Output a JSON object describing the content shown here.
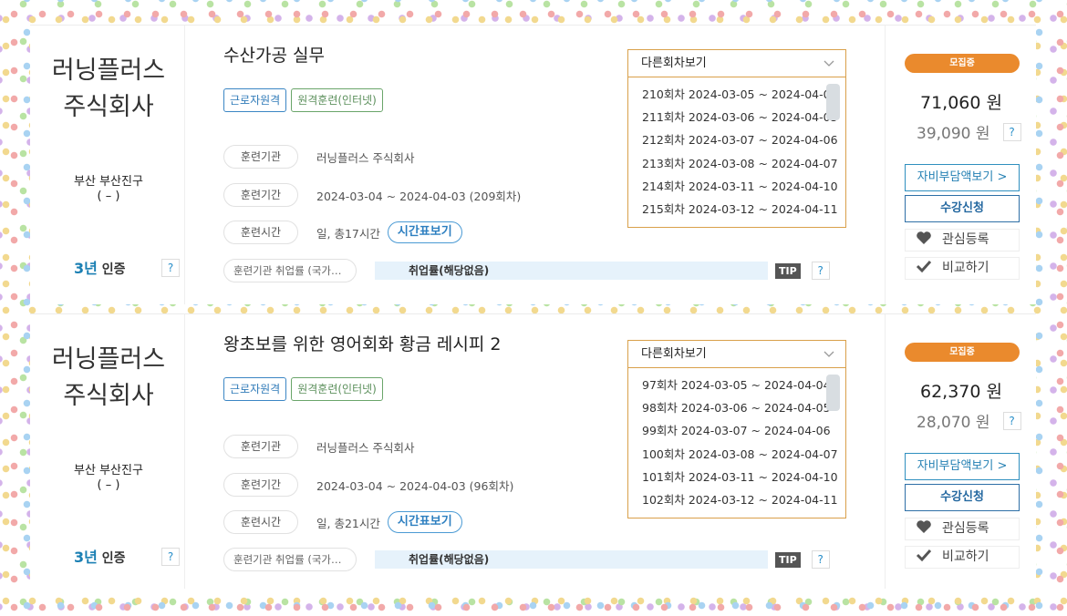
{
  "courses": [
    {
      "company": "러닝플러스\n주식회사",
      "region": "부산 부산진구\n( – )",
      "cert_years": "3년",
      "cert_label": "인증",
      "title": "수산가공 실무",
      "tags": [
        "근로자원격",
        "원격훈련(인터넷)"
      ],
      "labels": {
        "institution": "훈련기관",
        "period": "훈련기간",
        "time": "훈련시간"
      },
      "institution": "러닝플러스 주식회사",
      "period": "2024-03-04 ~ 2024-04-03 (209회차)",
      "time": "일, 총17시간",
      "schedule_button": "시간표보기",
      "employment_label": "훈련기관 취업률 (국가…",
      "employment_rate": "취업률(해당없음)",
      "tip": "TIP",
      "other_rounds_label": "다른회차보기",
      "rounds": [
        "210회차 2024-03-05 ~ 2024-04-04",
        "211회차 2024-03-06 ~ 2024-04-05",
        "212회차 2024-03-07 ~ 2024-04-06",
        "213회차 2024-03-08 ~ 2024-04-07",
        "214회차 2024-03-11 ~ 2024-04-10",
        "215회차 2024-03-12 ~ 2024-04-11"
      ],
      "status": "모집중",
      "price": "71,060 원",
      "self_cost": "39,090 원",
      "self_cost_button": "자비부담액보기 >",
      "apply_button": "수강신청",
      "like_button": "관심등록",
      "compare_button": "비교하기"
    },
    {
      "company": "러닝플러스\n주식회사",
      "region": "부산 부산진구\n( – )",
      "cert_years": "3년",
      "cert_label": "인증",
      "title": "왕초보를 위한 영어회화 황금 레시피 2",
      "tags": [
        "근로자원격",
        "원격훈련(인터넷)"
      ],
      "labels": {
        "institution": "훈련기관",
        "period": "훈련기간",
        "time": "훈련시간"
      },
      "institution": "러닝플러스 주식회사",
      "period": "2024-03-04 ~ 2024-04-03 (96회차)",
      "time": "일, 총21시간",
      "schedule_button": "시간표보기",
      "employment_label": "훈련기관 취업률 (국가…",
      "employment_rate": "취업률(해당없음)",
      "tip": "TIP",
      "other_rounds_label": "다른회차보기",
      "rounds": [
        "97회차 2024-03-05 ~ 2024-04-04",
        "98회차 2024-03-06 ~ 2024-04-05",
        "99회차 2024-03-07 ~ 2024-04-06",
        "100회차 2024-03-08 ~ 2024-04-07",
        "101회차 2024-03-11 ~ 2024-04-10",
        "102회차 2024-03-12 ~ 2024-04-11"
      ],
      "status": "모집중",
      "price": "62,370 원",
      "self_cost": "28,070 원",
      "self_cost_button": "자비부담액보기 >",
      "apply_button": "수강신청",
      "like_button": "관심등록",
      "compare_button": "비교하기"
    }
  ],
  "help_glyph": "?",
  "icons": {
    "heart": "heart-icon",
    "check": "check-icon",
    "chevron": "chevron-down-icon"
  },
  "colors": {
    "accent": "#2f8fbf",
    "status": "#ea8a2d",
    "select_border": "#d9a04a"
  }
}
